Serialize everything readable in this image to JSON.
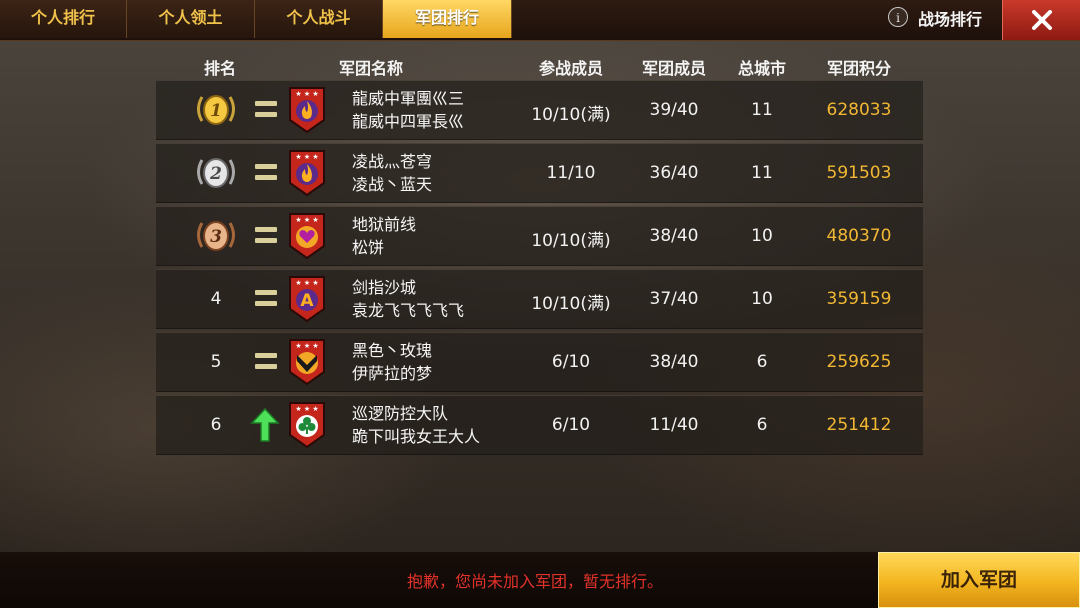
{
  "tabs": [
    {
      "label": "个人排行",
      "active": false
    },
    {
      "label": "个人领土",
      "active": false
    },
    {
      "label": "个人战斗",
      "active": false
    },
    {
      "label": "军团排行",
      "active": true
    }
  ],
  "top_right": {
    "info_icon": "info-icon",
    "battle_rank_label": "战场排行",
    "close_icon": "close-icon"
  },
  "table": {
    "headers": {
      "rank": "排名",
      "legion_name": "军团名称",
      "participants": "参战成员",
      "members": "军团成员",
      "cities": "总城市",
      "score": "军团积分"
    },
    "rows": [
      {
        "rank": "1",
        "rank_display": "gold-medal",
        "trend": "equal",
        "emblem": "fire-emblem",
        "legion": "龍威中軍團巛三",
        "leader": "龍威中四軍長巛",
        "participants": "10/10(满)",
        "members": "39/40",
        "cities": "11",
        "score": "628033"
      },
      {
        "rank": "2",
        "rank_display": "silver-medal",
        "trend": "equal",
        "emblem": "fire-emblem",
        "legion": "凌战灬苍穹",
        "leader": "凌战丶蓝天",
        "participants": "11/10",
        "members": "36/40",
        "cities": "11",
        "score": "591503"
      },
      {
        "rank": "3",
        "rank_display": "bronze-medal",
        "trend": "equal",
        "emblem": "heart-emblem",
        "legion": "地狱前线",
        "leader": "松饼",
        "participants": "10/10(满)",
        "members": "38/40",
        "cities": "10",
        "score": "480370"
      },
      {
        "rank": "4",
        "rank_display": "number",
        "trend": "equal",
        "emblem": "letter-a-emblem",
        "legion": "剑指沙城",
        "leader": "袁龙飞飞飞飞飞",
        "participants": "10/10(满)",
        "members": "37/40",
        "cities": "10",
        "score": "359159"
      },
      {
        "rank": "5",
        "rank_display": "number",
        "trend": "equal",
        "emblem": "chevron-emblem",
        "legion": "黑色丶玫瑰",
        "leader": "伊萨拉的梦",
        "participants": "6/10",
        "members": "38/40",
        "cities": "6",
        "score": "259625"
      },
      {
        "rank": "6",
        "rank_display": "number",
        "trend": "up",
        "emblem": "clover-emblem",
        "legion": "巡逻防控大队",
        "leader": "跪下叫我女王大人",
        "participants": "6/10",
        "members": "11/40",
        "cities": "6",
        "score": "251412"
      }
    ]
  },
  "footer": {
    "notice": "抱歉，您尚未加入军团，暂无排行。",
    "join_button": "加入军团"
  },
  "colors": {
    "accent_gold": "#f2b833",
    "notice_red": "#e2322a",
    "close_red": "#b52a1d",
    "active_tab": "#f3b51f"
  }
}
